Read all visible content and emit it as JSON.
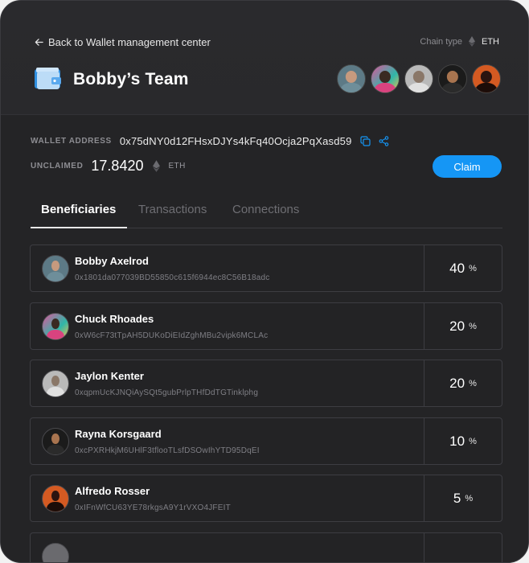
{
  "header": {
    "back_label": "Back to Wallet management center",
    "chain_type_label": "Chain type",
    "chain_type_value": "ETH",
    "team_name": "Bobby’s Team"
  },
  "wallet": {
    "address_label": "WALLET ADDRESS",
    "address": "0x75dNY0d12FHsxDJYs4kFq40Ocja2PqXasd59",
    "unclaimed_label": "UNCLAIMED",
    "unclaimed_amount": "17.8420",
    "unclaimed_unit": "ETH",
    "claim_label": "Claim"
  },
  "tabs": [
    {
      "label": "Beneficiaries",
      "active": true
    },
    {
      "label": "Transactions",
      "active": false
    },
    {
      "label": "Connections",
      "active": false
    }
  ],
  "beneficiaries": [
    {
      "name": "Bobby Axelrod",
      "address": "0x1801da077039BD55850c615f6944ec8C56B18adc",
      "percent": "40",
      "percent_sign": "%"
    },
    {
      "name": "Chuck Rhoades",
      "address": "0xW6cF73tTpAH5DUKoDiEIdZghMBu2vipk6MCLAc",
      "percent": "20",
      "percent_sign": "%"
    },
    {
      "name": "Jaylon Kenter",
      "address": "0xqpmUcKJNQiAySQt5gubPrlpTHfDdTGTinklphg",
      "percent": "20",
      "percent_sign": "%"
    },
    {
      "name": "Rayna Korsgaard",
      "address": "0xcPXRHkjM6UHlF3tflooTLsfDSOwIhYTD95DqEI",
      "percent": "10",
      "percent_sign": "%"
    },
    {
      "name": "Alfredo Rosser",
      "address": "0xIFnWfCU63YE78rkgsA9Y1rVXO4JFEIT",
      "percent": "5",
      "percent_sign": "%"
    }
  ],
  "colors": {
    "background": "#242426",
    "accent": "#1596f5"
  }
}
